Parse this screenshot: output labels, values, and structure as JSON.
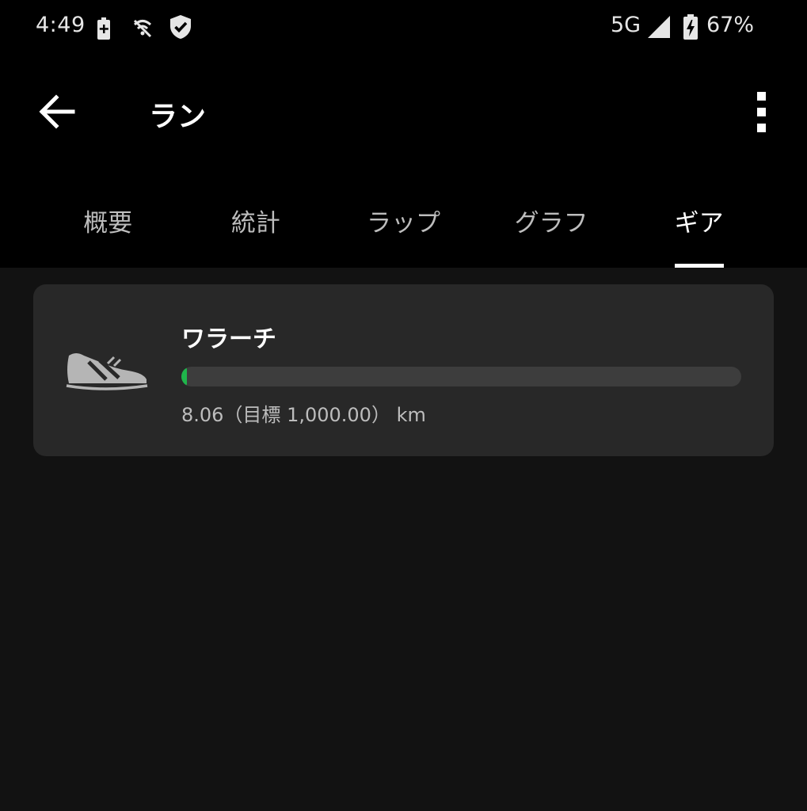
{
  "status_bar": {
    "time": "4:49",
    "network": "5G",
    "battery_percent": "67%"
  },
  "app_bar": {
    "title": "ラン"
  },
  "tabs": [
    {
      "label": "概要",
      "active": false
    },
    {
      "label": "統計",
      "active": false
    },
    {
      "label": "ラップ",
      "active": false
    },
    {
      "label": "グラフ",
      "active": false
    },
    {
      "label": "ギア",
      "active": true
    }
  ],
  "gear": {
    "name": "ワラーチ",
    "distance_text": "8.06（目標 1,000.00） km",
    "current_km": 8.06,
    "goal_km": 1000.0,
    "progress_color": "#1fb54b"
  },
  "icons": {
    "back": "arrow-left-icon",
    "overflow": "more-vert-icon",
    "gear": "shoe-icon",
    "battery_saver": "battery-plus-icon",
    "wifi_off": "wifi-off-icon",
    "shield": "shield-check-icon",
    "signal": "signal-icon",
    "battery_charging": "battery-charging-icon"
  }
}
